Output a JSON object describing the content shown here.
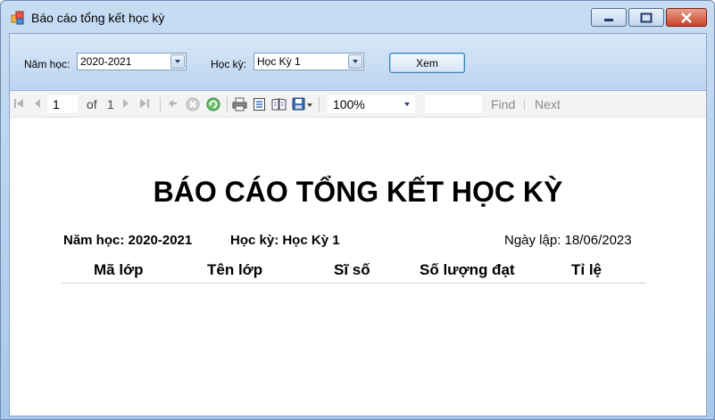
{
  "window": {
    "title": "Báo cáo tổng kết học kỳ"
  },
  "filter": {
    "nam_hoc_label": "Năm học:",
    "nam_hoc_value": "2020-2021",
    "hoc_ky_label": "Học kỳ:",
    "hoc_ky_value": "Học Kỳ 1",
    "xem_label": "Xem"
  },
  "toolbar": {
    "page_current": "1",
    "of_label": "of",
    "page_total": "1",
    "zoom": "100%",
    "find_label": "Find",
    "next_label": "Next",
    "icons": [
      "first-page-icon",
      "prev-page-icon",
      "next-page-icon",
      "last-page-icon",
      "back-icon",
      "stop-icon",
      "refresh-icon",
      "print-icon",
      "print-layout-icon",
      "page-setup-icon",
      "export-icon"
    ]
  },
  "report": {
    "title": "BÁO CÁO TỔNG KẾT HỌC KỲ",
    "nam_hoc": "Năm học: 2020-2021",
    "hoc_ky": "Học kỳ: Học Kỳ 1",
    "ngay_lap": "Ngày lập: 18/06/2023",
    "columns": [
      "Mã lớp",
      "Tên lớp",
      "Sĩ số",
      "Số lượng đạt",
      "Tỉ lệ"
    ]
  },
  "colors": {
    "titlebar": "#c7dcf2",
    "close_button": "#c8422a",
    "filter_bar": "#d9e8f8"
  }
}
